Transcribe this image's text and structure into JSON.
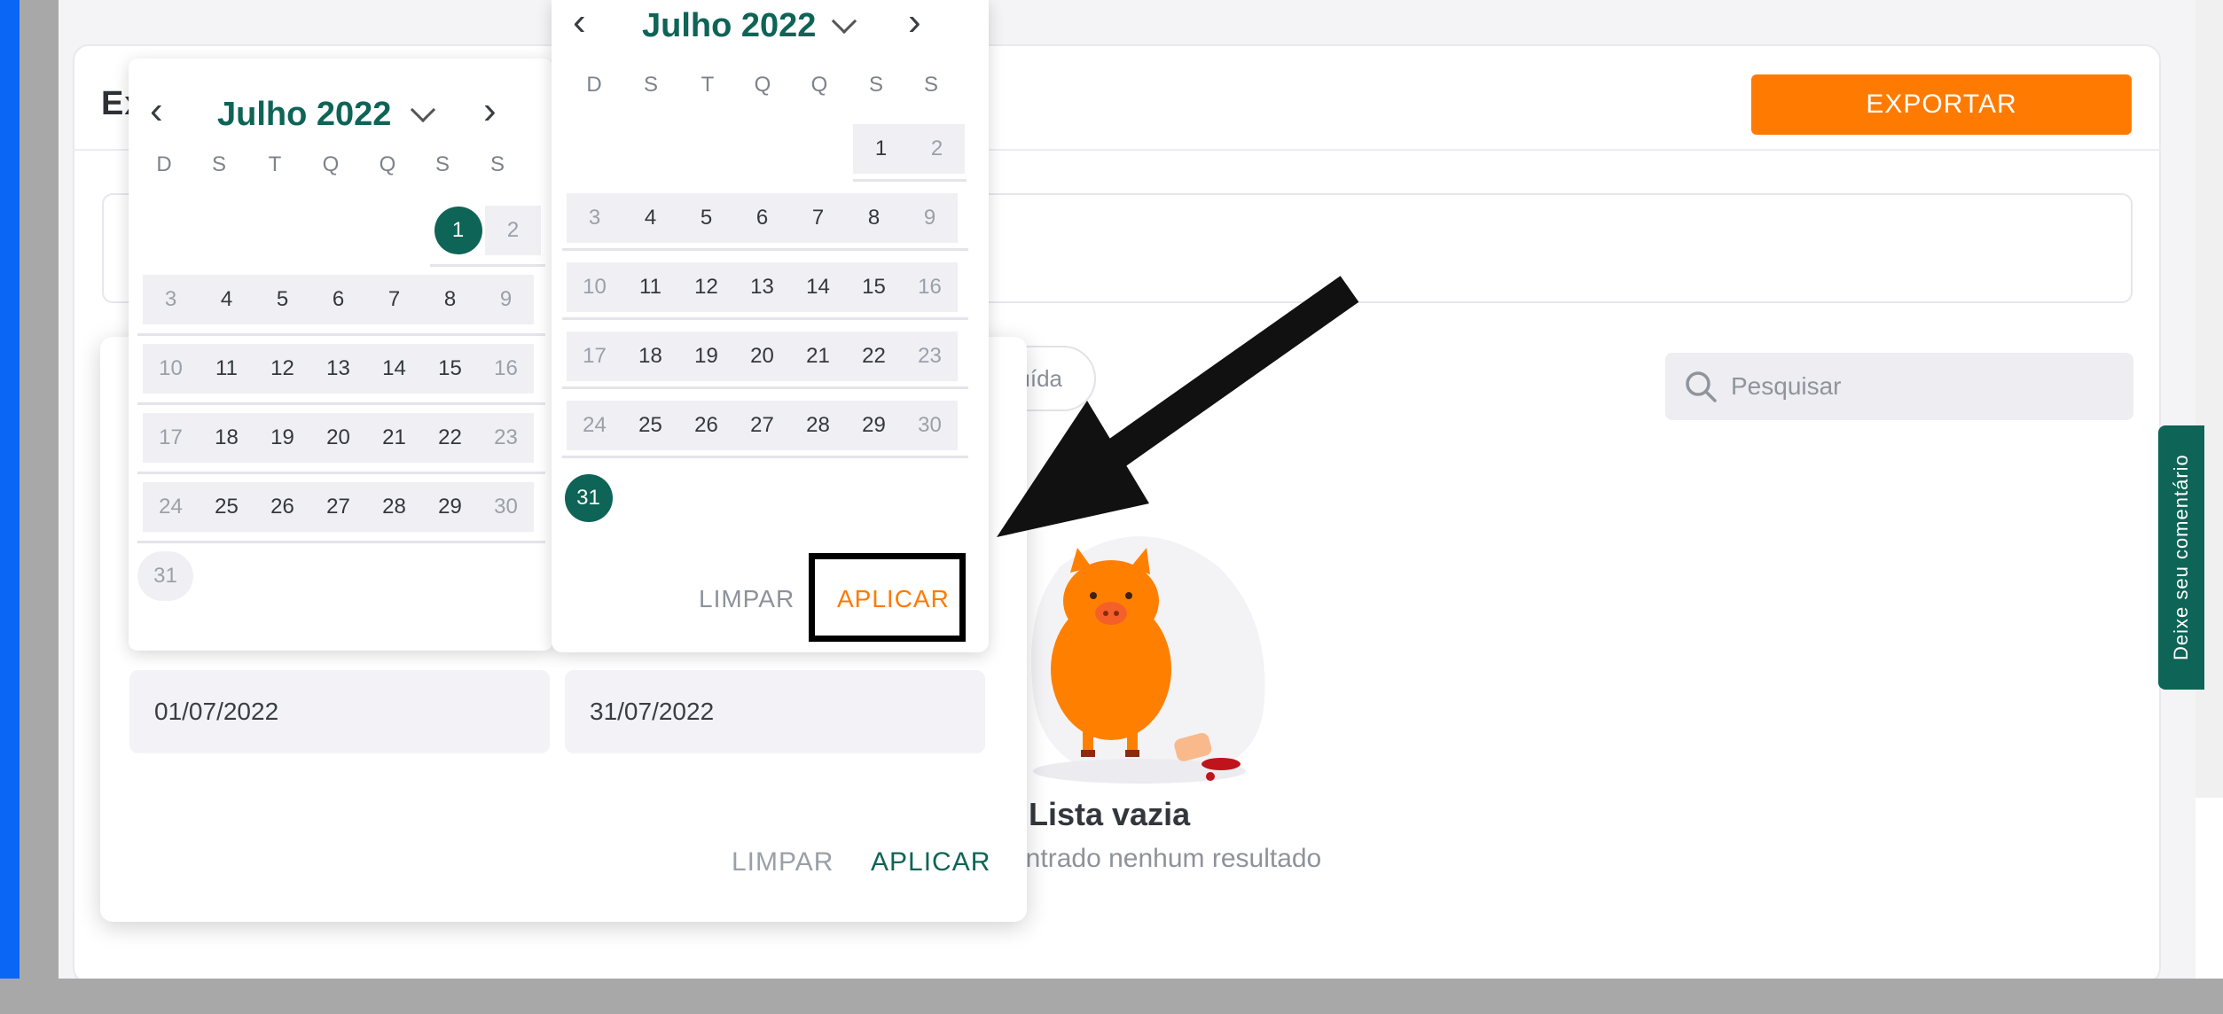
{
  "card": {
    "title": "Ex"
  },
  "toolbar": {
    "export_label": "EXPORTAR"
  },
  "filters": {
    "chip_label": "uída"
  },
  "search": {
    "placeholder": "Pesquisar"
  },
  "feedback": {
    "label": "Deixe seu comentário"
  },
  "empty_state": {
    "title": "Lista vazia",
    "subtitle": "ontrado nenhum resultado"
  },
  "date_range": {
    "start_value": "01/07/2022",
    "end_value": "31/07/2022",
    "clear_label": "LIMPAR",
    "apply_label": "APLICAR"
  },
  "calendar_left": {
    "month": "Julho 2022",
    "selected_day": "1"
  },
  "calendar_right": {
    "month": "Julho 2022",
    "selected_day": "31",
    "clear_label": "LIMPAR",
    "apply_label": "APLICAR"
  },
  "weekdays": [
    "D",
    "S",
    "T",
    "Q",
    "Q",
    "S",
    "S"
  ],
  "colors": {
    "accent_green": "#0e6456",
    "accent_orange": "#ff7a00",
    "left_bar_blue": "#0a66f5"
  },
  "icons": {
    "prev": "chevron-left-icon",
    "next": "chevron-right-icon",
    "dropdown": "chevron-down-icon",
    "search": "search-icon",
    "illustration": "pig-illustration-icon",
    "annotation": "arrow-icon"
  }
}
